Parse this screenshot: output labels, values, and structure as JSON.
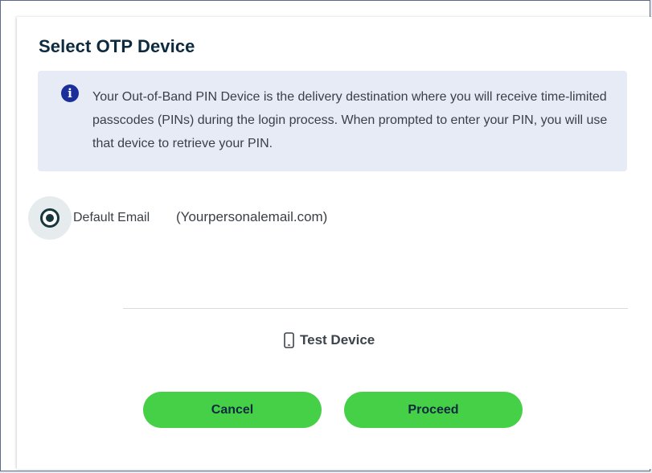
{
  "dialog": {
    "title": "Select OTP Device"
  },
  "info": {
    "icon": "info-icon",
    "icon_glyph": "i",
    "text": "Your Out-of-Band PIN Device is the delivery destination where you will receive time-limited passcodes (PINs) during the login process. When prompted to enter your PIN, you will use that device to retrieve your PIN.",
    "background_color": "#e7ebf6",
    "icon_color": "#1a2f9a"
  },
  "device_options": [
    {
      "label": "Default Email",
      "detail": "(Yourpersonalemail.com)",
      "selected": true
    }
  ],
  "test_device": {
    "icon": "phone-icon",
    "label": "Test Device"
  },
  "buttons": {
    "cancel_label": "Cancel",
    "proceed_label": "Proceed",
    "color": "#45d047"
  },
  "colors": {
    "title": "#0d2a3f",
    "text": "#3a3f47",
    "radio": "#17373e"
  }
}
